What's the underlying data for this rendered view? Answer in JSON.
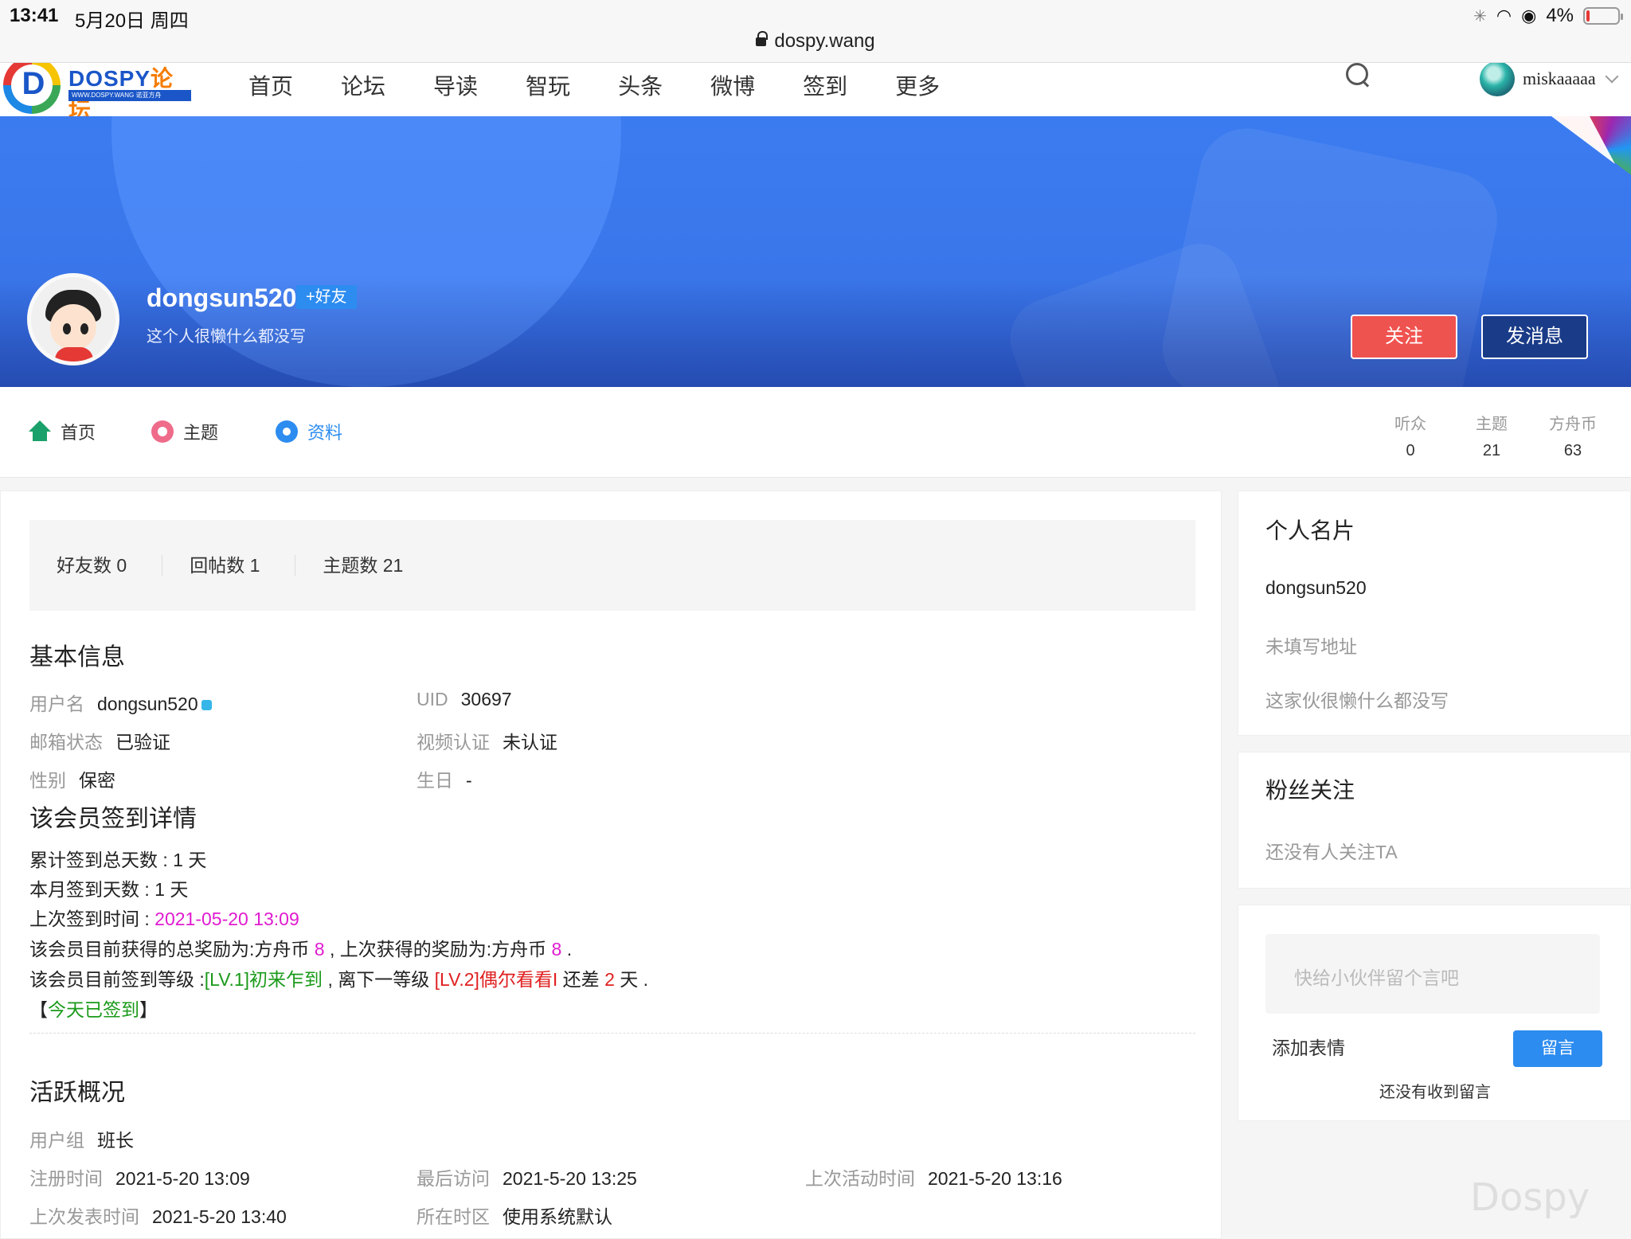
{
  "status": {
    "time": "13:41",
    "date": "5月20日 周四",
    "battery": "4%"
  },
  "browser": {
    "url": "dospy.wang"
  },
  "nav": {
    "logo_text": "DOSPY",
    "logo_text2": "论坛",
    "logo_sub": "WWW.DOSPY.WANG 诺亚方舟",
    "items": [
      "首页",
      "论坛",
      "导读",
      "智玩",
      "头条",
      "微博",
      "签到",
      "更多"
    ],
    "username": "miskaaaaa"
  },
  "profile": {
    "name": "dongsun520",
    "add_friend": "+好友",
    "signature": "这个人很懒什么都没写",
    "follow": "关注",
    "message": "发消息"
  },
  "tabs": [
    {
      "label": "首页"
    },
    {
      "label": "主题"
    },
    {
      "label": "资料"
    }
  ],
  "stats": [
    {
      "k": "听众",
      "v": "0"
    },
    {
      "k": "主题",
      "v": "21"
    },
    {
      "k": "方舟币",
      "v": "63"
    }
  ],
  "counts": [
    "好友数 0",
    "回帖数 1",
    "主题数 21"
  ],
  "basic": {
    "title": "基本信息",
    "username_k": "用户名",
    "username_v": "dongsun520",
    "uid_k": "UID",
    "uid_v": "30697",
    "email_k": "邮箱状态",
    "email_v": "已验证",
    "video_k": "视频认证",
    "video_v": "未认证",
    "gender_k": "性别",
    "gender_v": "保密",
    "birthday_k": "生日",
    "birthday_v": "-"
  },
  "signin": {
    "title": "该会员签到详情",
    "total": "累计签到总天数 : 1 天",
    "month": "本月签到天数 : 1 天",
    "last_prefix": "上次签到时间 : ",
    "last_time": "2021-05-20 13:09",
    "reward_a": "该会员目前获得的总奖励为:方舟币 ",
    "reward_total": "8",
    "reward_b": " , 上次获得的奖励为:方舟币 ",
    "reward_last": "8",
    "reward_c": " .",
    "level_a": "该会员目前签到等级 :",
    "level_cur": "[LV.1]初来乍到",
    "level_b": " , 离下一等级 ",
    "level_next": "[LV.2]偶尔看看I",
    "level_c": " 还差 ",
    "level_days": "2",
    "level_d": " 天 .",
    "today_a": "【",
    "today": "今天已签到",
    "today_b": "】"
  },
  "activity": {
    "title": "活跃概况",
    "group_k": "用户组",
    "group_v": "班长",
    "reg_k": "注册时间",
    "reg_v": "2021-5-20 13:09",
    "last_visit_k": "最后访问",
    "last_visit_v": "2021-5-20 13:25",
    "last_active_k": "上次活动时间",
    "last_active_v": "2021-5-20 13:16",
    "last_post_k": "上次发表时间",
    "last_post_v": "2021-5-20 13:40",
    "tz_k": "所在时区",
    "tz_v": "使用系统默认"
  },
  "card": {
    "title": "个人名片",
    "name": "dongsun520",
    "address": "未填写地址",
    "intro": "这家伙很懒什么都没写"
  },
  "fans": {
    "title": "粉丝关注",
    "empty": "还没有人关注TA"
  },
  "guestbook": {
    "placeholder": "快给小伙伴留个言吧",
    "emoji": "添加表情",
    "post": "留言",
    "empty": "还没有收到留言"
  },
  "watermark": "Dospy"
}
